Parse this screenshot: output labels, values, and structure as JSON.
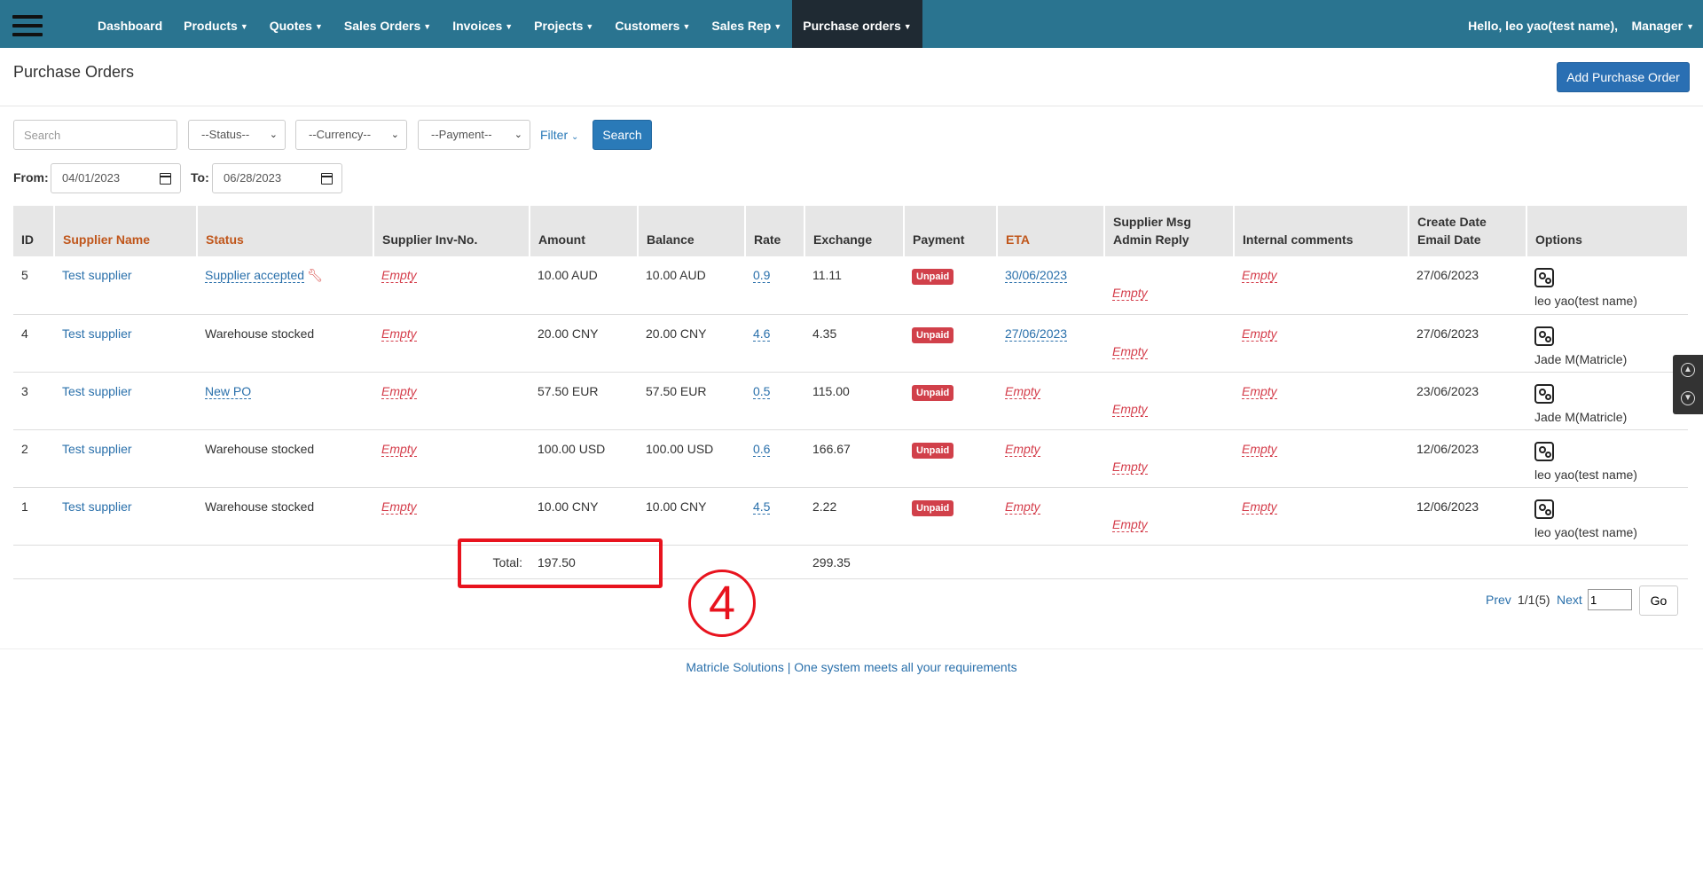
{
  "navbar": {
    "items": [
      {
        "label": "Dashboard",
        "dropdown": false
      },
      {
        "label": "Products",
        "dropdown": true
      },
      {
        "label": "Quotes",
        "dropdown": true
      },
      {
        "label": "Sales Orders",
        "dropdown": true
      },
      {
        "label": "Invoices",
        "dropdown": true
      },
      {
        "label": "Projects",
        "dropdown": true
      },
      {
        "label": "Customers",
        "dropdown": true
      },
      {
        "label": "Sales Rep",
        "dropdown": true
      },
      {
        "label": "Purchase orders",
        "dropdown": true,
        "active": true
      }
    ],
    "greeting": "Hello, leo yao(test name),",
    "role": "Manager"
  },
  "page": {
    "title": "Purchase Orders",
    "add_button": "Add Purchase Order"
  },
  "filters": {
    "search_placeholder": "Search",
    "status": "--Status--",
    "currency": "--Currency--",
    "payment": "--Payment--",
    "filter_link": "Filter",
    "search_button": "Search",
    "from_label": "From:",
    "from_value": "04/01/2023",
    "to_label": "To:",
    "to_value": "06/28/2023"
  },
  "table": {
    "headers": {
      "id": "ID",
      "supplier": "Supplier Name",
      "status": "Status",
      "inv_no": "Supplier Inv-No.",
      "amount": "Amount",
      "balance": "Balance",
      "rate": "Rate",
      "exchange": "Exchange",
      "payment": "Payment",
      "eta": "ETA",
      "msg_1": "Supplier Msg",
      "msg_2": "Admin Reply",
      "internal": "Internal comments",
      "date_1": "Create Date",
      "date_2": "Email Date",
      "options": "Options"
    },
    "rows": [
      {
        "id": "5",
        "supplier": "Test supplier",
        "status": "Supplier accepted",
        "status_type": "link",
        "inv_no": "Empty",
        "amount": "10.00 AUD",
        "balance": "10.00 AUD",
        "rate": "0.9",
        "exchange": "11.11",
        "payment": "Unpaid",
        "eta": "30/06/2023",
        "eta_type": "date",
        "msg": "Empty",
        "internal": "Empty",
        "create_date": "27/06/2023",
        "user": "leo yao(test name)"
      },
      {
        "id": "4",
        "supplier": "Test supplier",
        "status": "Warehouse stocked",
        "status_type": "text",
        "inv_no": "Empty",
        "amount": "20.00 CNY",
        "balance": "20.00 CNY",
        "rate": "4.6",
        "exchange": "4.35",
        "payment": "Unpaid",
        "eta": "27/06/2023",
        "eta_type": "date",
        "msg": "Empty",
        "internal": "Empty",
        "create_date": "27/06/2023",
        "user": "Jade M(Matricle)"
      },
      {
        "id": "3",
        "supplier": "Test supplier",
        "status": "New PO",
        "status_type": "link",
        "inv_no": "Empty",
        "amount": "57.50 EUR",
        "balance": "57.50 EUR",
        "rate": "0.5",
        "exchange": "115.00",
        "payment": "Unpaid",
        "eta": "Empty",
        "eta_type": "empty",
        "msg": "Empty",
        "internal": "Empty",
        "create_date": "23/06/2023",
        "user": "Jade M(Matricle)"
      },
      {
        "id": "2",
        "supplier": "Test supplier",
        "status": "Warehouse stocked",
        "status_type": "text",
        "inv_no": "Empty",
        "amount": "100.00 USD",
        "balance": "100.00 USD",
        "rate": "0.6",
        "exchange": "166.67",
        "payment": "Unpaid",
        "eta": "Empty",
        "eta_type": "empty",
        "msg": "Empty",
        "internal": "Empty",
        "create_date": "12/06/2023",
        "user": "leo yao(test name)"
      },
      {
        "id": "1",
        "supplier": "Test supplier",
        "status": "Warehouse stocked",
        "status_type": "text",
        "inv_no": "Empty",
        "amount": "10.00 CNY",
        "balance": "10.00 CNY",
        "rate": "4.5",
        "exchange": "2.22",
        "payment": "Unpaid",
        "eta": "Empty",
        "eta_type": "empty",
        "msg": "Empty",
        "internal": "Empty",
        "create_date": "12/06/2023",
        "user": "leo yao(test name)"
      }
    ],
    "total_label": "Total:",
    "total_amount": "197.50",
    "total_exchange": "299.35"
  },
  "annotation": {
    "step": "4"
  },
  "pagination": {
    "prev": "Prev",
    "info": "1/1(5)",
    "next": "Next",
    "page_value": "1",
    "go": "Go"
  },
  "footer": {
    "text": "Matricle Solutions | One system meets all your requirements"
  }
}
